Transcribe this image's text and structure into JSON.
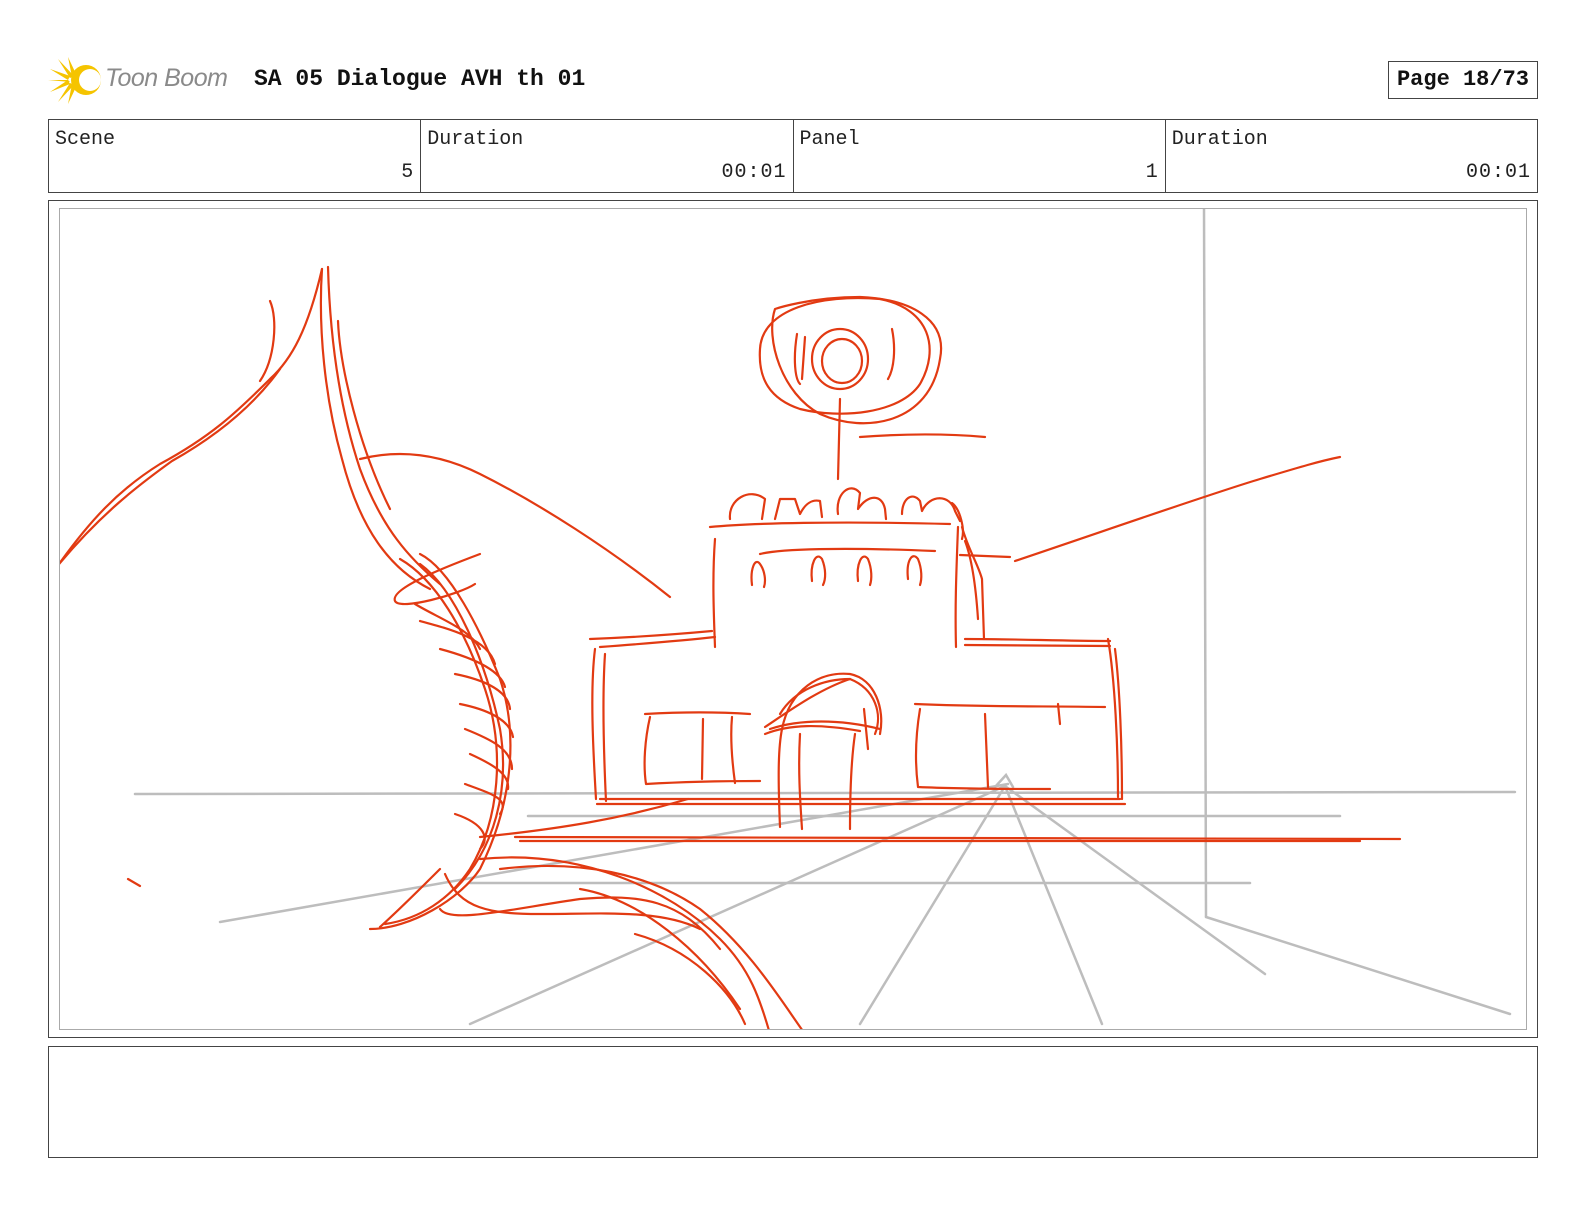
{
  "header": {
    "logo_text": "Toon Boom",
    "project_title": "SA 05 Dialogue AVH th 01",
    "page_label": "Page 18/73"
  },
  "info": [
    {
      "label": "Scene",
      "value": "5"
    },
    {
      "label": "Duration",
      "value": "00:01"
    },
    {
      "label": "Panel",
      "value": "1"
    },
    {
      "label": "Duration",
      "value": "00:01"
    }
  ],
  "notes": {
    "text": ""
  },
  "colors": {
    "sketch_red": "#e23a12",
    "guide_gray": "#bdbdbd",
    "logo_yellow": "#f5c400"
  },
  "icons": {
    "logo": "toon-boom-starburst-icon"
  }
}
